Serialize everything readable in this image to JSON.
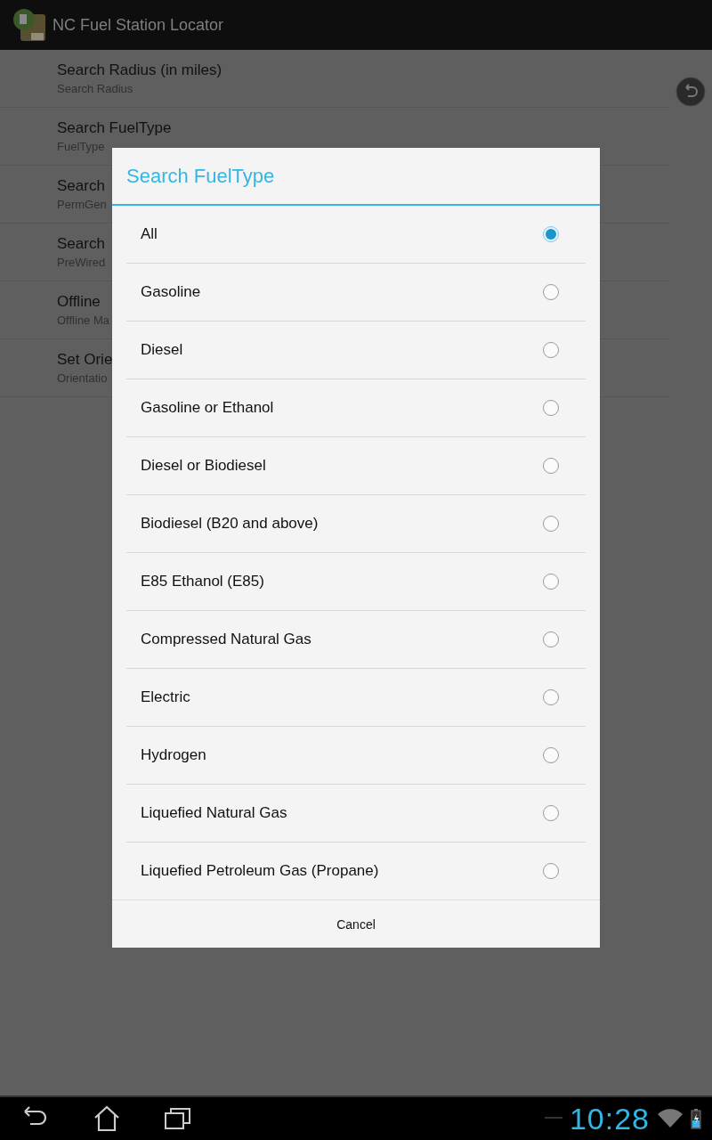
{
  "app_bar": {
    "title": "NC Fuel Station Locator"
  },
  "settings": [
    {
      "title": "Search Radius (in miles)",
      "summary": "Search Radius"
    },
    {
      "title": "Search FuelType",
      "summary": "FuelType"
    },
    {
      "title": "Search",
      "summary": "PermGen"
    },
    {
      "title": "Search",
      "summary": "PreWired"
    },
    {
      "title": "Offline",
      "summary": "Offline Ma"
    },
    {
      "title": "Set Orie",
      "summary": "Orientatio"
    }
  ],
  "dialog": {
    "title": "Search FuelType",
    "options": [
      {
        "label": "All",
        "selected": true
      },
      {
        "label": "Gasoline",
        "selected": false
      },
      {
        "label": "Diesel",
        "selected": false
      },
      {
        "label": "Gasoline or Ethanol",
        "selected": false
      },
      {
        "label": "Diesel or Biodiesel",
        "selected": false
      },
      {
        "label": "Biodiesel (B20 and above)",
        "selected": false
      },
      {
        "label": "E85 Ethanol (E85)",
        "selected": false
      },
      {
        "label": "Compressed Natural Gas",
        "selected": false
      },
      {
        "label": "Electric",
        "selected": false
      },
      {
        "label": "Hydrogen",
        "selected": false
      },
      {
        "label": "Liquefied Natural Gas",
        "selected": false
      },
      {
        "label": "Liquefied Petroleum Gas (Propane)",
        "selected": false
      }
    ],
    "cancel": "Cancel"
  },
  "status_bar": {
    "time": "10:28"
  }
}
